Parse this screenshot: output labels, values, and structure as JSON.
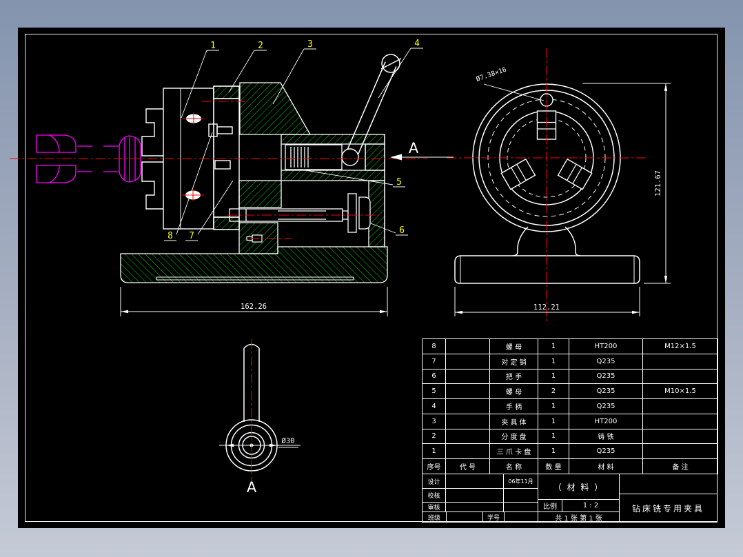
{
  "colors": {
    "background_top": "#8494ae",
    "background_bottom": "#c5cad6",
    "sheet": "#000000",
    "line": "#ffffff",
    "centerline": "#ff0000",
    "hatch": "#00dd00",
    "workpiece": "#ff00ff",
    "balloon": "#ffff00"
  },
  "front_view": {
    "balloons": [
      "1",
      "2",
      "3",
      "4",
      "5",
      "6",
      "7",
      "8"
    ],
    "dim_width": "162.26",
    "section_letter": "A"
  },
  "side_view": {
    "hole_label": "Ø7.38×16",
    "dim_height": "121.67",
    "dim_width": "112.21"
  },
  "detail_view": {
    "dim_label": "Ø30",
    "view_letter": "A"
  },
  "bom": {
    "header": {
      "seq": "序号",
      "code": "代 号",
      "name": "名 称",
      "qty": "数 量",
      "material": "材 料",
      "remark": "备 注"
    },
    "rows": [
      {
        "seq": "8",
        "code": "",
        "name": "螺 母",
        "qty": "1",
        "material": "HT200",
        "remark": "M12×1.5"
      },
      {
        "seq": "7",
        "code": "",
        "name": "对 定 销",
        "qty": "1",
        "material": "Q235",
        "remark": ""
      },
      {
        "seq": "6",
        "code": "",
        "name": "把 手",
        "qty": "1",
        "material": "Q235",
        "remark": ""
      },
      {
        "seq": "5",
        "code": "",
        "name": "螺 母",
        "qty": "2",
        "material": "Q235",
        "remark": "M10×1.5"
      },
      {
        "seq": "4",
        "code": "",
        "name": "手 柄",
        "qty": "1",
        "material": "Q235",
        "remark": ""
      },
      {
        "seq": "3",
        "code": "",
        "name": "夹 具 体",
        "qty": "1",
        "material": "HT200",
        "remark": ""
      },
      {
        "seq": "2",
        "code": "",
        "name": "分 度 盘",
        "qty": "1",
        "material": "铸 铁",
        "remark": ""
      },
      {
        "seq": "1",
        "code": "",
        "name": "三 爪 卡 盘",
        "qty": "1",
        "material": "Q235",
        "remark": ""
      }
    ]
  },
  "title_block": {
    "design_label": "设计",
    "check_label": "校核",
    "audit_label": "审核",
    "class_label": "班级",
    "student_id_label": "学号",
    "date": "06年11月",
    "material_text": "（ 材  料 ）",
    "scale_label": "比例",
    "scale_value": "1 : 2",
    "sheet_info": "共 1 张  第 1 张",
    "drawing_title": "钻床铣专用夹具"
  }
}
